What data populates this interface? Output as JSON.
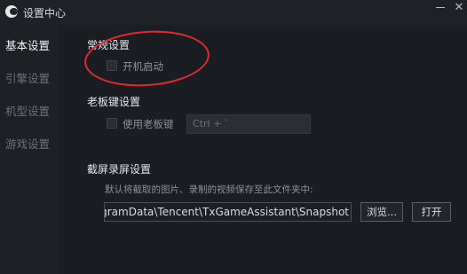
{
  "window": {
    "title": "设置中心",
    "minimize_icon": "minimize-icon",
    "close_icon": "close-icon",
    "close_glyph": "✕"
  },
  "sidebar": {
    "items": [
      {
        "label": "基本设置",
        "active": true
      },
      {
        "label": "引擎设置",
        "active": false
      },
      {
        "label": "机型设置",
        "active": false
      },
      {
        "label": "游戏设置",
        "active": false
      }
    ]
  },
  "general": {
    "title": "常规设置",
    "autostart_label": "开机启动",
    "autostart_checked": false
  },
  "boss_key": {
    "title": "老板键设置",
    "enable_label": "使用老板键",
    "enable_checked": false,
    "hotkey_value": "Ctrl + `"
  },
  "capture": {
    "title": "截屏录屏设置",
    "hint": "默认将截取的图片、录制的视频保存至此文件夹中:",
    "path_value": "gramData\\Tencent\\TxGameAssistant\\Snapshot",
    "browse_label": "浏览...",
    "open_label": "打开"
  },
  "colors": {
    "background": "#1a1d22",
    "annotation": "#e32a32"
  }
}
